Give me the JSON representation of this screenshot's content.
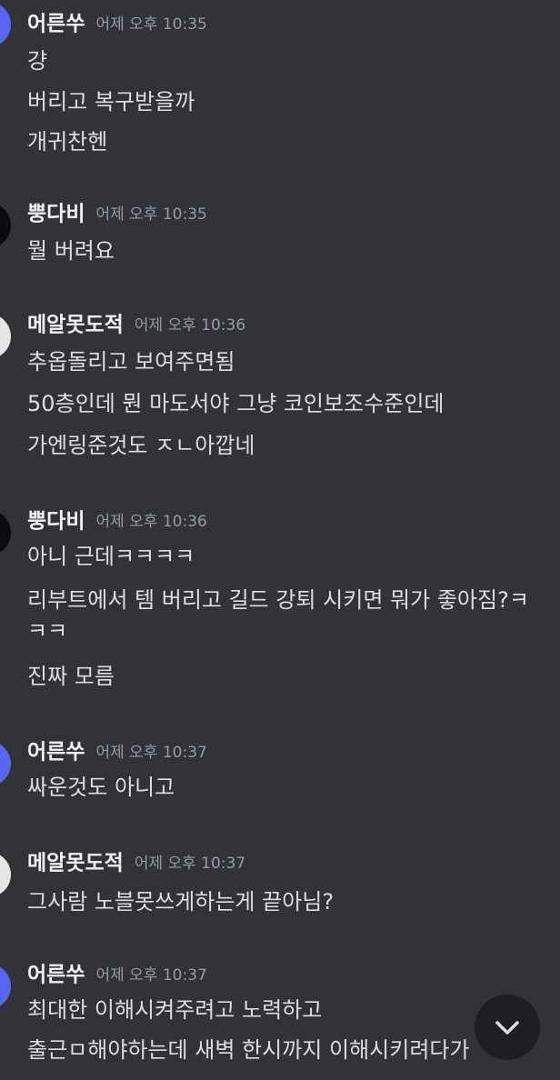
{
  "colors": {
    "background": "#313338",
    "author": "#f2f3f5",
    "timestamp": "#949ba4",
    "message": "#dbdee1",
    "avatar_blurple": "#5865f2",
    "avatar_black": "#0b0b0d",
    "avatar_white": "#e6e6e6",
    "scroll_button_bg": "#1e1f22"
  },
  "groups": [
    {
      "author": "어른쑤",
      "time": "어제 오후 10:35",
      "avatar_color": "blurple",
      "messages": [
        "걍",
        "버리고 복구받을까",
        "개귀찬헨"
      ]
    },
    {
      "author": "뿡다비",
      "time": "어제 오후 10:35",
      "avatar_color": "black",
      "messages": [
        "뭘 버려요"
      ]
    },
    {
      "author": "메알못도적",
      "time": "어제 오후 10:36",
      "avatar_color": "white",
      "messages": [
        "추옵돌리고 보여주면됨",
        "50층인데 뭔 마도서야 그냥 코인보조수준인데",
        "가엔링준것도 ㅈㄴ아깝네"
      ]
    },
    {
      "author": "뿡다비",
      "time": "어제 오후 10:36",
      "avatar_color": "black",
      "messages": [
        "아니 근데ㅋㅋㅋㅋ",
        "리부트에서 템 버리고 길드 강퇴 시키면 뭐가 좋아짐?ㅋㅋㅋ",
        "진짜 모름"
      ]
    },
    {
      "author": "어른쑤",
      "time": "어제 오후 10:37",
      "avatar_color": "blurple",
      "messages": [
        "싸운것도 아니고"
      ]
    },
    {
      "author": "메알못도적",
      "time": "어제 오후 10:37",
      "avatar_color": "white",
      "messages": [
        "그사람 노블못쓰게하는게 끝아님?"
      ]
    },
    {
      "author": "어른쑤",
      "time": "어제 오후 10:37",
      "avatar_color": "blurple",
      "messages": [
        "최대한 이해시켜주려고 노력하고",
        "출근ㅁ해야하는데 새벽 한시까지 이해시키려다가"
      ]
    }
  ],
  "scroll_button": {
    "icon": "chevron-down-icon"
  }
}
